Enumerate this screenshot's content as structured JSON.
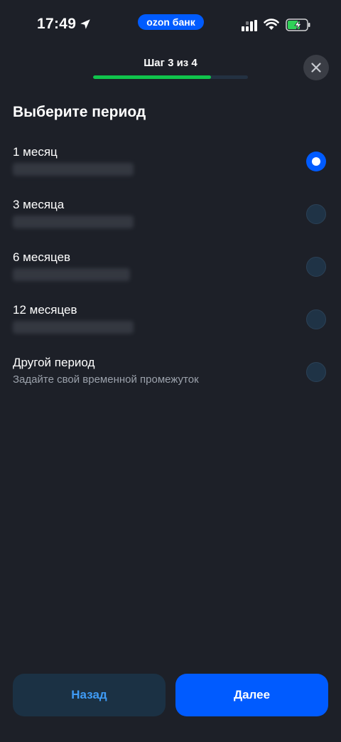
{
  "status_bar": {
    "time": "17:49",
    "app_pill": "ozon банк",
    "icons": [
      "location-arrow-icon",
      "cellular-signal-icon",
      "wifi-icon",
      "battery-charging-icon"
    ]
  },
  "header": {
    "step_label": "Шаг 3 из 4",
    "progress": 0.75,
    "progress_color": "#10c44c",
    "close_icon": "close-icon"
  },
  "title": "Выберите период",
  "options": [
    {
      "label": "1 месяц",
      "selected": true
    },
    {
      "label": "3 месяца",
      "selected": false
    },
    {
      "label": "6 месяцев",
      "selected": false
    },
    {
      "label": "12 месяцев",
      "selected": false
    },
    {
      "label": "Другой период",
      "subtitle": "Задайте свой временной промежуток",
      "selected": false
    }
  ],
  "buttons": {
    "back_label": "Назад",
    "next_label": "Далее"
  },
  "colors": {
    "background": "#1d2028",
    "accent": "#005bff",
    "back_button_text": "#3f9bf5"
  }
}
